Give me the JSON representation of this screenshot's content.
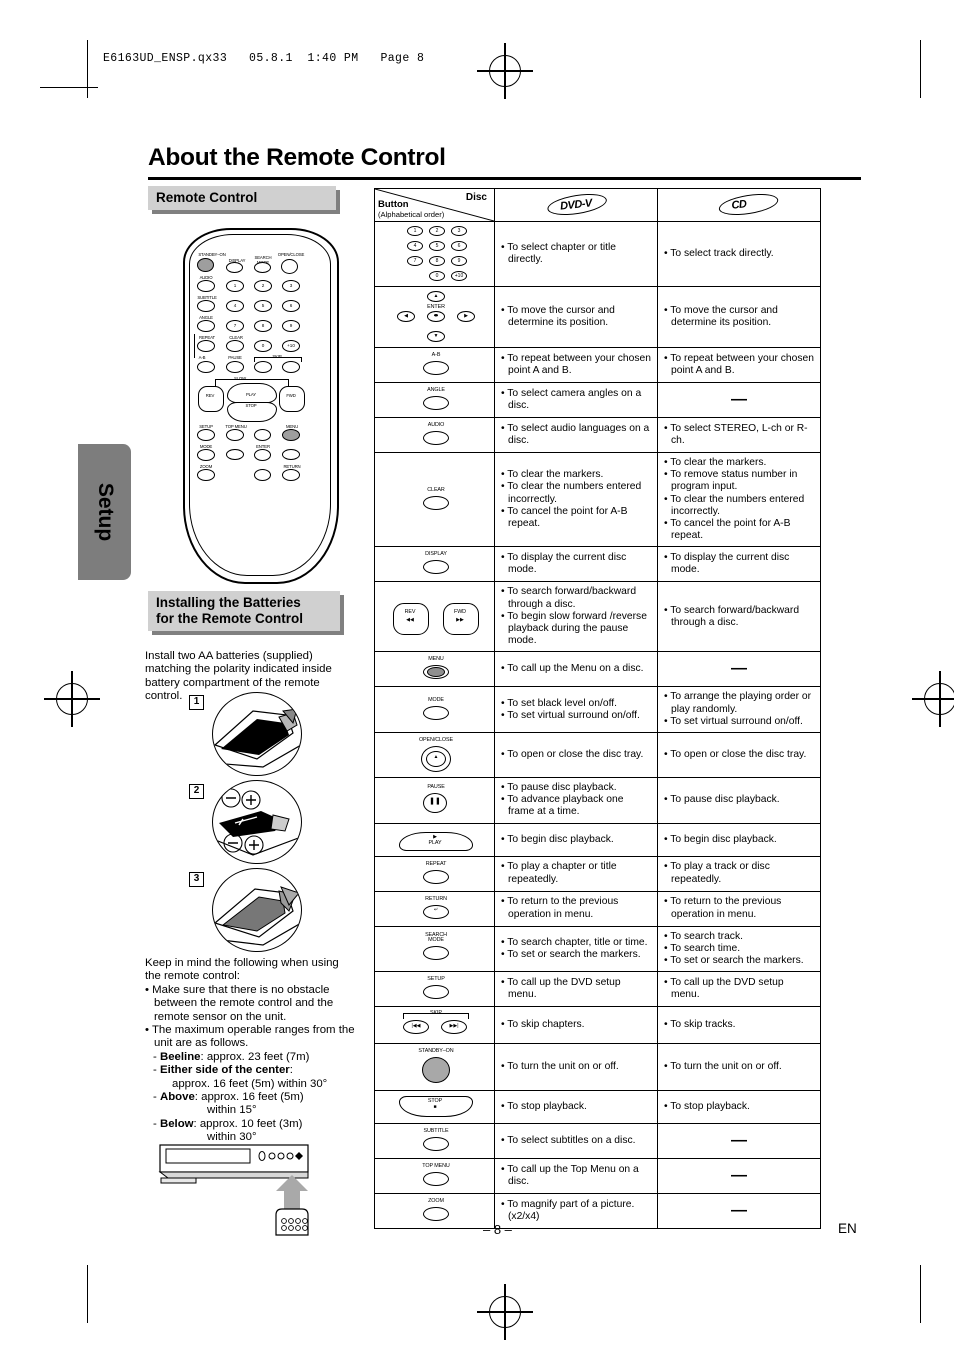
{
  "print_header": "E6163UD_ENSP.qx33   05.8.1  1:40 PM   Page 8",
  "page": {
    "title": "About the Remote Control",
    "number": "– 8 –",
    "language": "EN"
  },
  "sidebar": {
    "tab_label": "Setup"
  },
  "left_column": {
    "section1_title": "Remote Control",
    "section2_title_line1": "Installing the Batteries",
    "section2_title_line2": "for the Remote Control",
    "intro": "Install two AA batteries (supplied) matching the polarity indicated inside battery compartment of the remote control.",
    "steps": [
      "1",
      "2",
      "3"
    ],
    "notes_heading": "Keep in mind the following when using the remote control:",
    "bullets": [
      "Make sure that there is no obstacle between the remote control and the remote sensor on the unit.",
      "The maximum operable ranges from the unit are as follows."
    ],
    "ranges": [
      {
        "label": "Beeline",
        "value": ": approx. 23 feet (7m)",
        "extra": ""
      },
      {
        "label": "Either side of the center",
        "value": ":",
        "extra": "approx. 16 feet (5m) within 30°"
      },
      {
        "label": "Above",
        "value": ":  approx. 16 feet (5m)",
        "extra": "within 15°"
      },
      {
        "label": "Below",
        "value": ":  approx. 10 feet (3m)",
        "extra": "within 30°"
      }
    ]
  },
  "remote_diagram": {
    "labels": {
      "standby": "STANDBY–ON",
      "display": "DISPLAY",
      "search_mode_l1": "SEARCH",
      "search_mode_l2": "MODE",
      "open_close": "OPEN/CLOSE",
      "audio": "AUDIO",
      "subtitle": "SUBTITLE",
      "angle": "ANGLE",
      "repeat": "REPEAT",
      "clear": "CLEAR",
      "ab": "A-B",
      "pause": "PAUSE",
      "skip": "SKIP",
      "slow": "SLOW",
      "play": "PLAY",
      "stop": "STOP",
      "rev": "REV",
      "fwd": "FWD",
      "setup": "SETUP",
      "top_menu": "TOP MENU",
      "menu": "MENU",
      "mode": "MODE",
      "enter": "ENTER",
      "zoom": "ZOOM",
      "return": "RETURN"
    },
    "numbers": [
      "1",
      "2",
      "3",
      "4",
      "5",
      "6",
      "7",
      "8",
      "9",
      "0",
      "+10"
    ]
  },
  "table": {
    "header": {
      "button_label": "Button",
      "button_sub": "(Alphabetical order)",
      "disc_label": "Disc",
      "col_dvd": "DVD-V",
      "col_cd": "CD"
    },
    "rows": [
      {
        "button": {
          "type": "numpad",
          "keys": [
            "1",
            "2",
            "3",
            "4",
            "5",
            "6",
            "7",
            "8",
            "9",
            "0",
            "+10"
          ]
        },
        "dvd": [
          "To select chapter or title directly."
        ],
        "cd": [
          "To select track directly."
        ]
      },
      {
        "button": {
          "type": "cursor",
          "label": "ENTER"
        },
        "dvd": [
          "To move the cursor and determine its position."
        ],
        "cd": [
          "To move the cursor and determine its position."
        ]
      },
      {
        "button": {
          "type": "single",
          "label": "A-B"
        },
        "dvd": [
          "To repeat between your chosen point A and B."
        ],
        "cd": [
          "To repeat between your chosen point A and B."
        ]
      },
      {
        "button": {
          "type": "single",
          "label": "ANGLE"
        },
        "dvd": [
          "To select camera angles on a disc."
        ],
        "cd": null
      },
      {
        "button": {
          "type": "single",
          "label": "AUDIO"
        },
        "dvd": [
          "To select audio languages on a disc."
        ],
        "cd": [
          "To select STEREO, L-ch or R-ch."
        ]
      },
      {
        "button": {
          "type": "single",
          "label": "CLEAR"
        },
        "dvd": [
          "To clear the markers.",
          "To clear the numbers entered incorrectly.",
          "To cancel the point for A-B repeat."
        ],
        "cd": [
          "To clear the markers.",
          "To remove status number in program input.",
          "To clear the numbers entered incorrectly.",
          "To cancel the point for A-B repeat."
        ]
      },
      {
        "button": {
          "type": "single",
          "label": "DISPLAY"
        },
        "dvd": [
          "To display the current disc mode."
        ],
        "cd": [
          "To display the current disc mode."
        ]
      },
      {
        "button": {
          "type": "revfwd",
          "label_left": "REV",
          "label_right": "FWD"
        },
        "dvd": [
          "To search forward/backward through a disc.",
          "To begin slow forward /reverse playback during the pause mode."
        ],
        "cd": [
          "To search forward/backward through a disc."
        ]
      },
      {
        "button": {
          "type": "filled",
          "label": "MENU"
        },
        "dvd": [
          "To call up the Menu on a disc."
        ],
        "cd": null
      },
      {
        "button": {
          "type": "single",
          "label": "MODE"
        },
        "dvd": [
          "To set black level on/off.",
          "To set virtual surround on/off."
        ],
        "cd": [
          "To arrange the playing order or play randomly.",
          "To set virtual surround on/off."
        ]
      },
      {
        "button": {
          "type": "eject",
          "label": "OPEN/CLOSE"
        },
        "dvd": [
          "To open or close the disc tray."
        ],
        "cd": [
          "To open or close the disc tray."
        ]
      },
      {
        "button": {
          "type": "pause",
          "label": "PAUSE"
        },
        "dvd": [
          "To pause disc playback.",
          "To advance playback one frame at a time."
        ],
        "cd": [
          "To pause disc playback."
        ]
      },
      {
        "button": {
          "type": "play",
          "label": "PLAY"
        },
        "dvd": [
          "To begin disc playback."
        ],
        "cd": [
          "To begin disc playback."
        ]
      },
      {
        "button": {
          "type": "single",
          "label": "REPEAT"
        },
        "dvd": [
          "To play a chapter or title repeatedly."
        ],
        "cd": [
          "To play a track or disc repeatedly."
        ]
      },
      {
        "button": {
          "type": "return",
          "label": "RETURN"
        },
        "dvd": [
          "To return to the previous operation in menu."
        ],
        "cd": [
          "To return to the previous operation in menu."
        ]
      },
      {
        "button": {
          "type": "single2",
          "label1": "SEARCH",
          "label2": "MODE"
        },
        "dvd": [
          "To search chapter, title or time.",
          "To set or search the markers."
        ],
        "cd": [
          "To search track.",
          "To search time.",
          "To set or search the markers."
        ]
      },
      {
        "button": {
          "type": "single",
          "label": "SETUP"
        },
        "dvd": [
          "To call up the DVD setup menu."
        ],
        "cd": [
          "To call up the DVD setup menu."
        ]
      },
      {
        "button": {
          "type": "skip",
          "label": "SKIP"
        },
        "dvd": [
          "To skip chapters."
        ],
        "cd": [
          "To skip tracks."
        ]
      },
      {
        "button": {
          "type": "standby",
          "label": "STANDBY–ON"
        },
        "dvd": [
          "To turn the unit on or off."
        ],
        "cd": [
          "To turn the unit on or off."
        ]
      },
      {
        "button": {
          "type": "stop",
          "label": "STOP"
        },
        "dvd": [
          "To stop playback."
        ],
        "cd": [
          "To stop playback."
        ]
      },
      {
        "button": {
          "type": "single",
          "label": "SUBTITLE"
        },
        "dvd": [
          "To select subtitles on a disc."
        ],
        "cd": null
      },
      {
        "button": {
          "type": "single",
          "label": "TOP MENU"
        },
        "dvd": [
          "To call up the Top Menu on a disc."
        ],
        "cd": null
      },
      {
        "button": {
          "type": "single",
          "label": "ZOOM"
        },
        "dvd": [
          "To magnify part of a picture. (x2/x4)"
        ],
        "cd": null
      }
    ],
    "empty_mark": "—"
  }
}
